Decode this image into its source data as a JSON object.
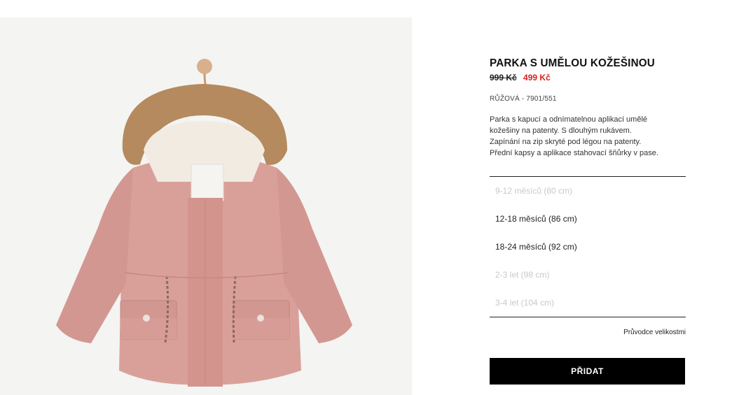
{
  "product": {
    "title": "PARKA S UMĚLOU KOŽEŠINOU",
    "price_old": "999 Kč",
    "price_new": "499 Kč",
    "color_ref": "RŮŽOVÁ - 7901/551",
    "description": [
      "Parka s kapucí a odnímatelnou aplikací umělé",
      "kožešiny na patenty. S dlouhým rukávem.",
      "Zapínání na zip skryté pod légou na patenty.",
      "Přední kapsy a aplikace stahovací šňůrky v pase."
    ]
  },
  "sizes": [
    {
      "label": "9-12 měsíců (80 cm)",
      "available": false
    },
    {
      "label": "12-18 měsíců (86 cm)",
      "available": true
    },
    {
      "label": "18-24 měsíců (92 cm)",
      "available": true
    },
    {
      "label": "2-3 let (98 cm)",
      "available": false
    },
    {
      "label": "3-4 let (104 cm)",
      "available": false
    }
  ],
  "size_guide_label": "Průvodce velikostmi",
  "add_button_label": "PŘIDAT",
  "colors": {
    "sale_price": "#d62020",
    "button_bg": "#000000",
    "jacket": "#d9a09a",
    "fur": "#b48a5e"
  }
}
